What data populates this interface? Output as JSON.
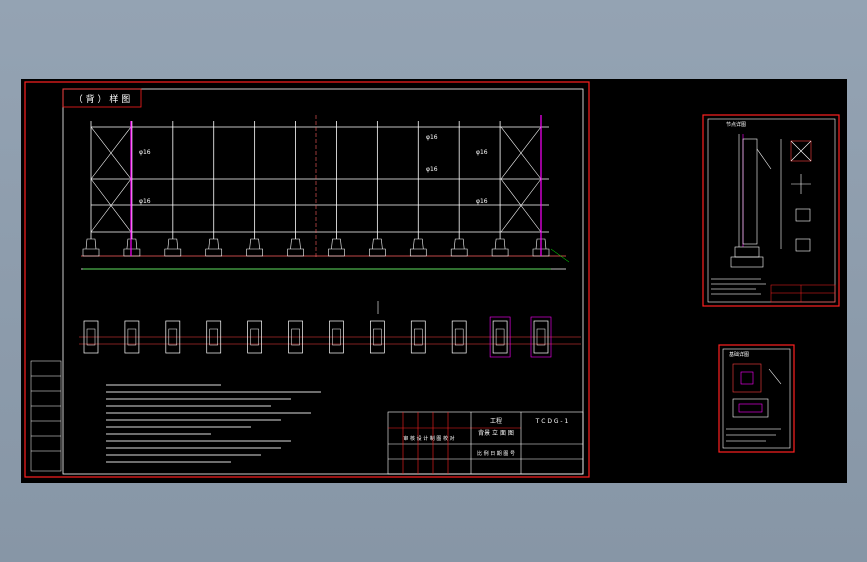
{
  "colors": {
    "background": "#8f9fb0",
    "canvas": "#000000",
    "frame": "#ff2020",
    "line": "#ffffff",
    "accent": "#ff00ff",
    "dim": "#00ff00",
    "yellow": "#ffff00",
    "text": "#ffffff"
  },
  "main_sheet": {
    "title": "（ 背 ） 样 图",
    "elevation_labels": [
      "φ16",
      "φ16",
      "φ16",
      "φ16",
      "φ16",
      "φ16"
    ],
    "bay_count": 12,
    "foundation_count": 12,
    "title_block": {
      "drawing_no": "T  C  D  G - 1",
      "project": "工程",
      "name_line": "背景 立 面 图",
      "stamp_row": "审 核 设 计 制 图 校 对",
      "scale_row": "比 例    日 期    图 号"
    }
  },
  "detail_sheet_1": {
    "title": "节点详图"
  },
  "detail_sheet_2": {
    "title": "基础详图"
  }
}
